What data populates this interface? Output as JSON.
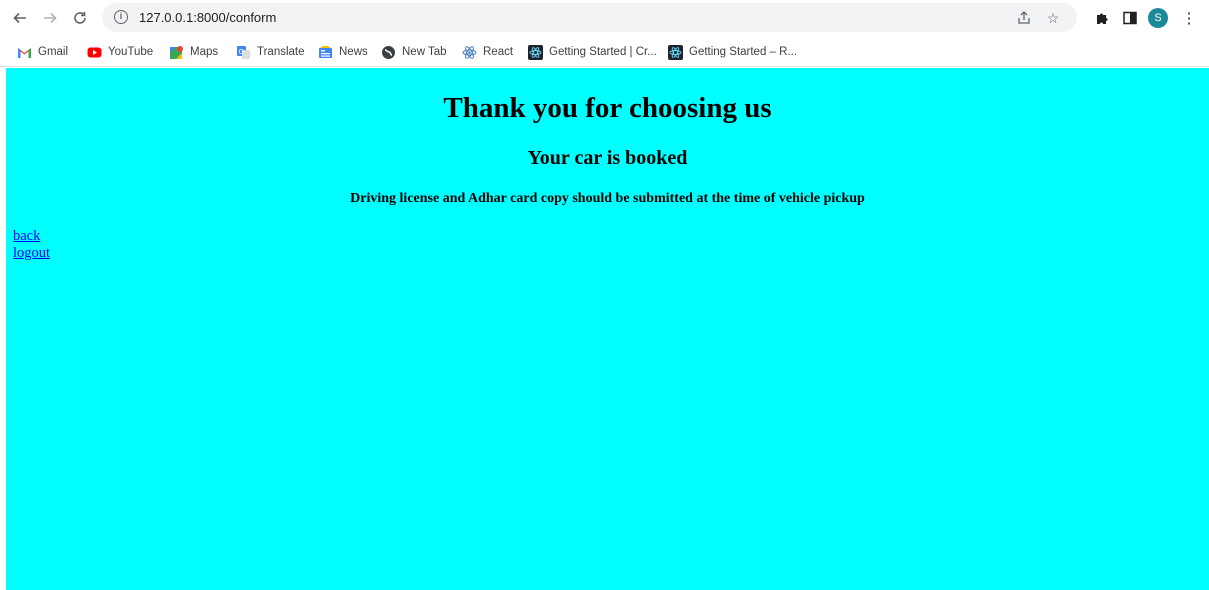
{
  "browser": {
    "url": "127.0.0.1:8000/conform",
    "avatar_letter": "S",
    "icons": {
      "back": "arrow-left-icon",
      "forward": "arrow-right-icon",
      "reload": "reload-icon",
      "site_info": "info-icon",
      "share": "share-icon",
      "bookmark": "star-icon",
      "extensions": "puzzle-icon",
      "side_panel": "side-panel-icon",
      "menu": "kebab-menu-icon"
    }
  },
  "bookmarks": [
    {
      "label": "Gmail",
      "icon": "gmail-icon"
    },
    {
      "label": "YouTube",
      "icon": "youtube-icon"
    },
    {
      "label": "Maps",
      "icon": "maps-icon"
    },
    {
      "label": "Translate",
      "icon": "translate-icon"
    },
    {
      "label": "News",
      "icon": "news-icon"
    },
    {
      "label": "New Tab",
      "icon": "globe-icon"
    },
    {
      "label": "React",
      "icon": "react-icon"
    },
    {
      "label": "Getting Started | Cr...",
      "icon": "react-native-icon"
    },
    {
      "label": "Getting Started – R...",
      "icon": "react-native-icon"
    }
  ],
  "page": {
    "background": "#00ffff",
    "heading": "Thank you for choosing us",
    "subheading": "Your car is booked",
    "note": "Driving license and Adhar card copy should be submitted at the time of vehicle pickup",
    "links": {
      "back": "back",
      "logout": "logout"
    },
    "link_color": "#0000ee"
  }
}
